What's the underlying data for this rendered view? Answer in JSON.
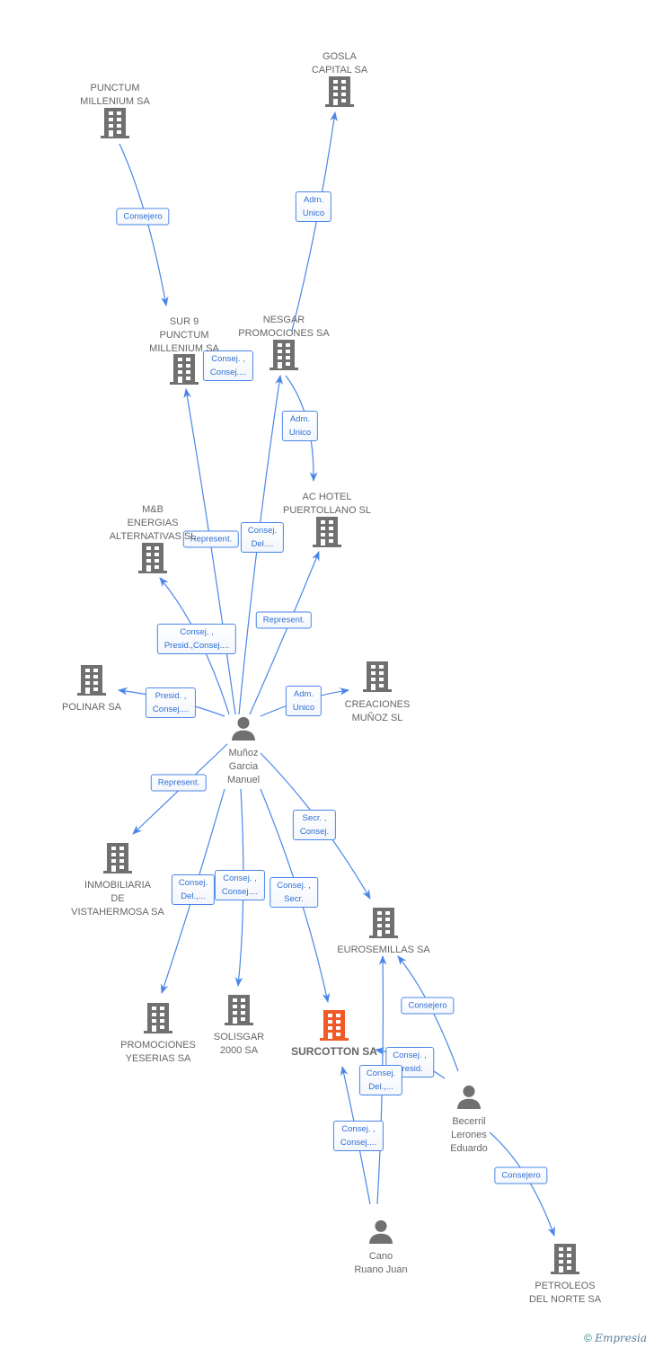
{
  "colors": {
    "edge": "#4a86e8",
    "node": "#707070",
    "focus": "#f05a28"
  },
  "nodes": [
    {
      "id": "gosla",
      "type": "company",
      "lines": [
        "GOSLA",
        "CAPITAL SA"
      ]
    },
    {
      "id": "punctum",
      "type": "company",
      "lines": [
        "PUNCTUM",
        "MILLENIUM SA"
      ]
    },
    {
      "id": "sur9",
      "type": "company",
      "lines": [
        "SUR 9",
        "PUNCTUM",
        "MILLENIUM SA"
      ]
    },
    {
      "id": "nesgar",
      "type": "company",
      "lines": [
        "NESGAR",
        "PROMOCIONES SA"
      ]
    },
    {
      "id": "achotel",
      "type": "company",
      "lines": [
        "AC HOTEL",
        "PUERTOLLANO SL"
      ]
    },
    {
      "id": "mb",
      "type": "company",
      "lines": [
        "M&B",
        "ENERGIAS",
        "ALTERNATIVAS SL"
      ]
    },
    {
      "id": "polinar",
      "type": "company",
      "lines": [
        "POLINAR SA"
      ]
    },
    {
      "id": "creaciones",
      "type": "company",
      "lines": [
        "CREACIONES",
        "MUÑOZ SL"
      ]
    },
    {
      "id": "munoz",
      "type": "person",
      "lines": [
        "Muñoz",
        "Garcia",
        "Manuel"
      ]
    },
    {
      "id": "inmobiliaria",
      "type": "company",
      "lines": [
        "INMOBILIARIA",
        "DE",
        "VISTAHERMOSA SA"
      ]
    },
    {
      "id": "eurosemillas",
      "type": "company",
      "lines": [
        "EUROSEMILLAS SA"
      ]
    },
    {
      "id": "promociones",
      "type": "company",
      "lines": [
        "PROMOCIONES",
        "YESERIAS SA"
      ]
    },
    {
      "id": "solisgar",
      "type": "company",
      "lines": [
        "SOLISGAR",
        "2000 SA"
      ]
    },
    {
      "id": "surcotton",
      "type": "company",
      "focus": true,
      "lines": [
        "SURCOTTON SA"
      ]
    },
    {
      "id": "becerril",
      "type": "person",
      "lines": [
        "Becerril",
        "Lerones",
        "Eduardo"
      ]
    },
    {
      "id": "cano",
      "type": "person",
      "lines": [
        "Cano",
        "Ruano Juan"
      ]
    },
    {
      "id": "petroleos",
      "type": "company",
      "lines": [
        "PETROLEOS",
        "DEL NORTE SA"
      ]
    }
  ],
  "edges": [
    {
      "from": "punctum",
      "to": "sur9",
      "label": [
        "Consejero"
      ]
    },
    {
      "from": "nesgar",
      "to": "gosla",
      "label": [
        "Adm.",
        "Unico"
      ]
    },
    {
      "from": "munoz",
      "to": "sur9",
      "label": [
        "Represent."
      ]
    },
    {
      "from": "munoz",
      "to": "sur9",
      "label": [
        "Consej. ,",
        "Consej...."
      ]
    },
    {
      "from": "munoz",
      "to": "nesgar",
      "label": [
        "Consej.",
        "Del...."
      ]
    },
    {
      "from": "nesgar",
      "to": "achotel",
      "label": [
        "Adm.",
        "Unico"
      ]
    },
    {
      "from": "munoz",
      "to": "achotel",
      "label": [
        "Represent."
      ]
    },
    {
      "from": "munoz",
      "to": "mb",
      "label": [
        "Consej. ,",
        "Presid.,Consej...."
      ]
    },
    {
      "from": "munoz",
      "to": "polinar",
      "label": [
        "Presid. ,",
        "Consej...."
      ]
    },
    {
      "from": "munoz",
      "to": "creaciones",
      "label": [
        "Adm.",
        "Unico"
      ]
    },
    {
      "from": "munoz",
      "to": "inmobiliaria",
      "label": [
        "Represent."
      ]
    },
    {
      "from": "munoz",
      "to": "eurosemillas",
      "label": [
        "Secr. ,",
        "Consej."
      ]
    },
    {
      "from": "munoz",
      "to": "promociones",
      "label": [
        "Consej.",
        "Del.,..."
      ]
    },
    {
      "from": "munoz",
      "to": "solisgar",
      "label": [
        "Consej. ,",
        "Consej...."
      ]
    },
    {
      "from": "munoz",
      "to": "surcotton",
      "label": [
        "Consej. ,",
        "Secr."
      ]
    },
    {
      "from": "becerril",
      "to": "eurosemillas",
      "label": [
        "Consejero"
      ]
    },
    {
      "from": "becerril",
      "to": "surcotton",
      "label": [
        "Consej. ,",
        "Presid."
      ]
    },
    {
      "from": "cano",
      "to": "eurosemillas",
      "label": [
        "Consej.",
        "Del.,..."
      ]
    },
    {
      "from": "cano",
      "to": "surcotton",
      "label": [
        "Consej. ,",
        "Consej...."
      ]
    },
    {
      "from": "becerril",
      "to": "petroleos",
      "label": [
        "Consejero"
      ]
    }
  ],
  "footer": {
    "copyright": "©",
    "brand": "Empresia"
  }
}
